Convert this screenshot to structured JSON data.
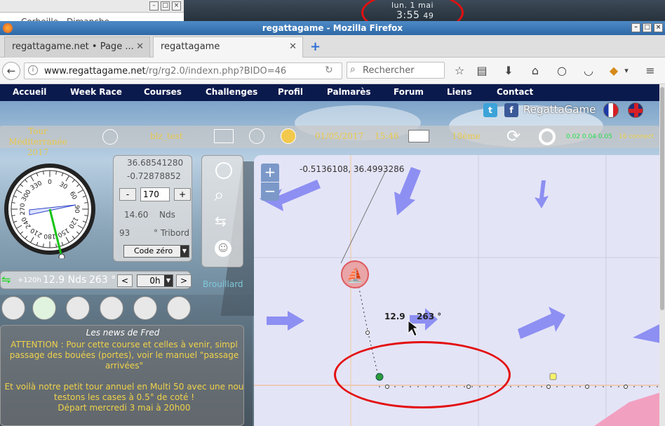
{
  "desktop": {
    "left_window_title": "Corbeille - Dimanche",
    "clock_date": "lun.   1 mai",
    "clock_time": "3:55",
    "clock_seconds": "49"
  },
  "browser": {
    "window_title": "regattagame - Mozilla Firefox",
    "tabs": [
      {
        "label": "regattagame.net • Page ..."
      },
      {
        "label": "regattagame"
      }
    ],
    "url_domain": "www.regattagame.net",
    "url_path": "/rg/rg2.0/indexn.php?BIDO=46",
    "search_placeholder": "Rechercher"
  },
  "site": {
    "menu": [
      "Accueil",
      "Week Race",
      "Courses",
      "Challenges",
      "Profil",
      "Palmarès",
      "Forum",
      "Liens",
      "Contact"
    ],
    "brand": "RegattaGame",
    "race_name": "Tour Méditerranée 2017",
    "player": "blz_test",
    "date": "01/05/2017",
    "time": "15:46",
    "rank": "18ème",
    "perf_values": "0.02 0.04 0.05",
    "connected": "16 connect"
  },
  "control": {
    "lat": "36.68541280",
    "lon": "-0.72878852",
    "heading": "170",
    "speed": "14.60",
    "speed_unit": "Nds",
    "twa": "93",
    "twa_unit": "° Tribord",
    "sail": "Code zéro",
    "minus_label": "-",
    "plus_label": "+"
  },
  "forecast": {
    "time_offset": "+120h",
    "speed": "12.9 Nds",
    "direction": "263 °",
    "hours": "0h",
    "prev": "<",
    "next": ">",
    "brouillard": "Brouillard"
  },
  "map": {
    "cursor_coords": "-0.5136108, 36.4993286",
    "wind_label_speed": "12.9",
    "wind_label_dir": "263 °",
    "zoom_in": "+",
    "zoom_out": "−"
  },
  "news": {
    "title": "Les news de Fred",
    "lines": [
      "ATTENTION : Pour cette course et celles à venir, simpl",
      "passage des bouées (portes), voir le manuel \"passage",
      "arrivées\"",
      "",
      "Et voilà notre petit tour annuel en Multi 50 avec une nou",
      "testons les cases à 0.5° de coté !",
      "Départ mercredi 3 mai à 20h00"
    ]
  },
  "compass_labels": [
    "0",
    "30",
    "60",
    "90",
    "120",
    "150",
    "180",
    "210",
    "240",
    "270",
    "300",
    "330"
  ]
}
